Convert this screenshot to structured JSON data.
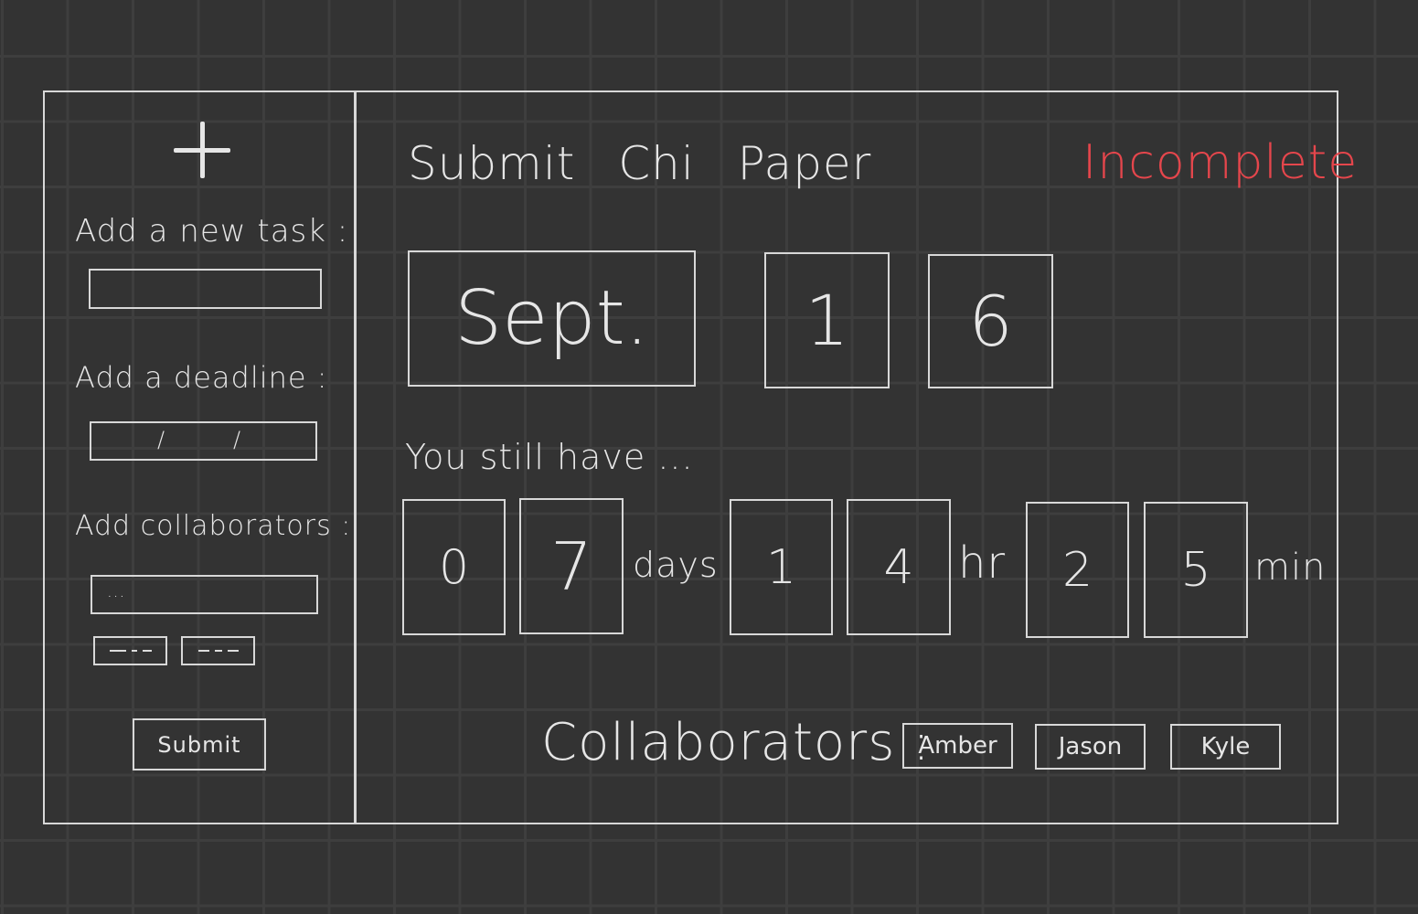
{
  "sidebar": {
    "add_icon": "plus-icon",
    "task_label": "Add a new task :",
    "task_value": "",
    "deadline_label": "Add a deadline :",
    "deadline_separators": [
      "/",
      "/"
    ],
    "collaborators_label": "Add collaborators :",
    "collaborators_placeholder": "...",
    "submit_label": "Submit"
  },
  "task": {
    "title": "Submit Chi Paper",
    "status": "Incomplete",
    "status_color": "#e5464c",
    "deadline": {
      "month": "Sept.",
      "day_digits": [
        "1",
        "6"
      ]
    },
    "countdown_label": "You still have ...",
    "days_digits": [
      "0",
      "7"
    ],
    "days_unit": "days",
    "hours_digits": [
      "1",
      "4"
    ],
    "hours_unit": "hr",
    "minutes_digits": [
      "2",
      "5"
    ],
    "minutes_unit": "min",
    "collaborators_label": "Collaborators :",
    "collaborators": [
      "Amber",
      "Jason",
      "Kyle"
    ]
  }
}
